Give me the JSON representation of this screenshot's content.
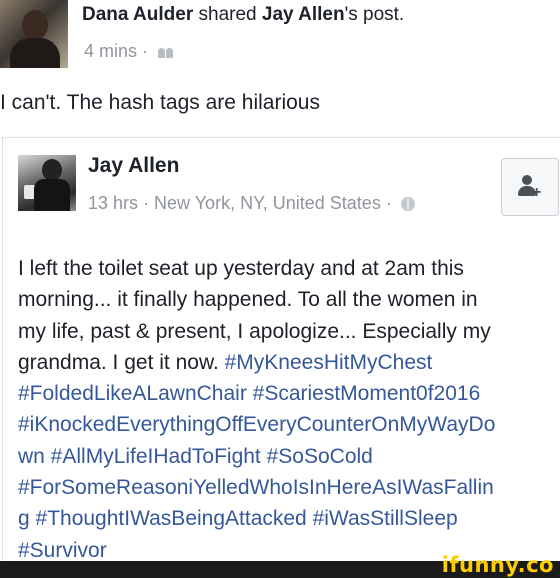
{
  "share_header": {
    "sharer_name": "Dana Aulder",
    "verb": " shared ",
    "original_author": "Jay Allen",
    "suffix": "'s post.",
    "timestamp": "4 mins · ",
    "privacy_icon": "friends-icon"
  },
  "status_text": "I can't. The hash tags are hilarious",
  "original_post": {
    "author": "Jay Allen",
    "meta": "13 hrs · New York, NY, United States · ",
    "privacy_icon": "globe-icon",
    "add_friend_icon": "add-friend-icon",
    "body_lines": [
      {
        "text": "I left the toilet seat up yesterday and at 2am this",
        "tag": ""
      },
      {
        "text": "morning... it finally happened. To all the women in",
        "tag": ""
      },
      {
        "text": "my life, past & present, I apologize... Especially my",
        "tag": ""
      },
      {
        "text": "grandma. I get it now. ",
        "tag": "#MyKneesHitMyChest"
      },
      {
        "text": "",
        "tag": "#FoldedLikeALawnChair #ScariestMoment0f2016"
      },
      {
        "text": "",
        "tag": "#iKnockedEverythingOffEveryCounterOnMyWayDo"
      },
      {
        "text": "",
        "tag": "wn #AllMyLifeIHadToFight #SoSoCold"
      },
      {
        "text": "",
        "tag": "#ForSomeReasoniYelledWhoIsInHereAsIWasFallin"
      },
      {
        "text": "",
        "tag": "g #ThoughtIWasBeingAttacked #iWasStillSleep"
      },
      {
        "text": "",
        "tag": "#Survivor"
      }
    ]
  },
  "watermark": {
    "text": "ifunny.co",
    "color": "#ffcc00"
  },
  "colors": {
    "text": "#1d2129",
    "meta": "#90949c",
    "hashtag": "#365899"
  }
}
